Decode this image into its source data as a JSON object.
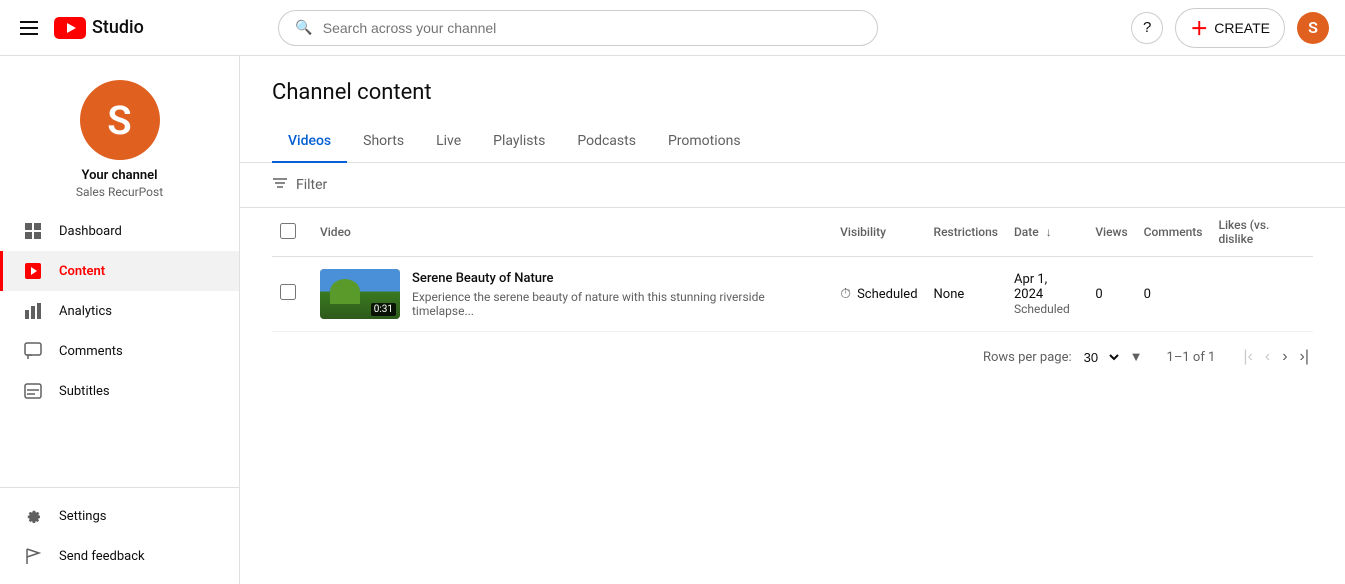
{
  "topnav": {
    "logo_text": "Studio",
    "search_placeholder": "Search across your channel",
    "create_label": "CREATE",
    "avatar_letter": "S",
    "help_label": "?"
  },
  "sidebar": {
    "channel_name": "Your channel",
    "channel_sub": "Sales RecurPost",
    "avatar_letter": "S",
    "nav_items": [
      {
        "id": "dashboard",
        "label": "Dashboard",
        "icon": "grid"
      },
      {
        "id": "content",
        "label": "Content",
        "icon": "play",
        "active": true
      },
      {
        "id": "analytics",
        "label": "Analytics",
        "icon": "bar-chart"
      },
      {
        "id": "comments",
        "label": "Comments",
        "icon": "comment"
      },
      {
        "id": "subtitles",
        "label": "Subtitles",
        "icon": "subtitles"
      },
      {
        "id": "settings",
        "label": "Settings",
        "icon": "gear"
      },
      {
        "id": "send-feedback",
        "label": "Send feedback",
        "icon": "flag"
      }
    ]
  },
  "page": {
    "title": "Channel content",
    "tabs": [
      "Videos",
      "Shorts",
      "Live",
      "Playlists",
      "Podcasts",
      "Promotions"
    ],
    "active_tab": "Videos",
    "filter_label": "Filter"
  },
  "table": {
    "columns": [
      "Video",
      "Visibility",
      "Restrictions",
      "Date",
      "Views",
      "Comments",
      "Likes (vs. dislike"
    ],
    "rows": [
      {
        "title": "Serene Beauty of Nature",
        "description": "Experience the serene beauty of nature with this stunning riverside timelapse...",
        "duration": "0:31",
        "visibility": "Scheduled",
        "restrictions": "None",
        "date": "Apr 1, 2024",
        "date_sub": "Scheduled",
        "views": "0",
        "comments": "0",
        "likes": ""
      }
    ]
  },
  "pagination": {
    "rows_per_page_label": "Rows per page:",
    "rows_per_page_value": "30",
    "page_info": "1–1 of 1"
  }
}
